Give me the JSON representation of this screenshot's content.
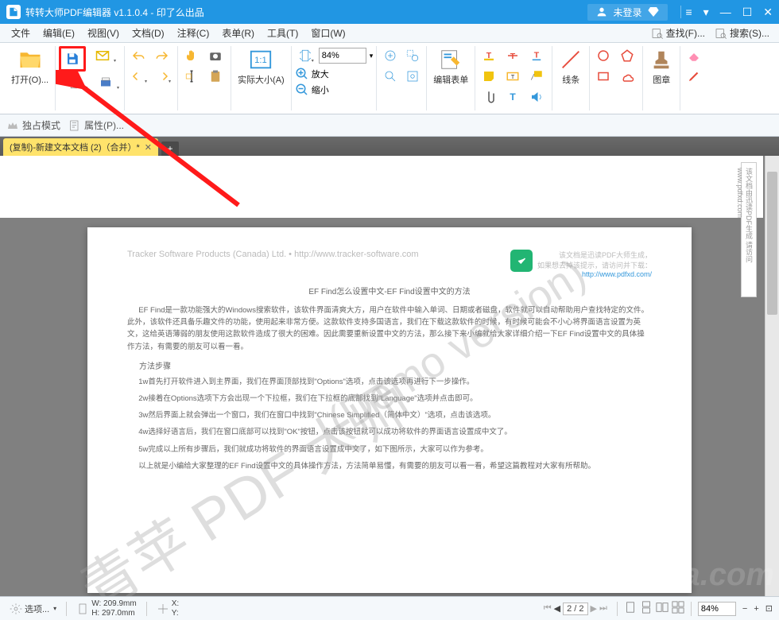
{
  "titlebar": {
    "title": "转转大师PDF编辑器 v1.1.0.4 - 印了么出品",
    "user_status": "未登录"
  },
  "menubar": {
    "items": [
      "文件",
      "编辑(E)",
      "视图(V)",
      "文档(D)",
      "注释(C)",
      "表单(R)",
      "工具(T)",
      "窗口(W)"
    ],
    "find_label": "查找(F)...",
    "search_label": "搜索(S)..."
  },
  "ribbon": {
    "open_label": "打开(O)...",
    "actual_size_label": "实际大小(A)",
    "zoom_value": "84%",
    "zoom_in_label": "放大",
    "zoom_out_label": "缩小",
    "edit_form_label": "编辑表单",
    "lines_label": "线条",
    "stamp_label": "图章"
  },
  "secondbar": {
    "exclusive_label": "独占模式",
    "props_label": "属性(P)..."
  },
  "tabbar": {
    "tab1": "(复制)-新建文本文档 (2)（合并）*"
  },
  "document": {
    "header_left": "Tracker Software Products (Canada) Ltd. • http://www.tracker-software.com",
    "header_note1": "该文档是迅读PDF大师生成，",
    "header_note2": "如果想去掉该提示，请访问并下载：",
    "header_link": "http://www.pdfxd.com/",
    "subtitle": "EF Find怎么设置中文-EF Find设置中文的方法",
    "para1": "EF Find是一款功能强大的Windows搜索软件，该软件界面清爽大方，用户在软件中输入单词、日期或者磁盘，软件就可以自动帮助用户查找特定的文件。此外，该软件还具备乐趣文件的功能，使用起来非常方便。这款软件支持多国语言，我们在下载这款软件的时候，有时候可能会不小心将界面语言设置为英文，这给英语薄弱的朋友使用这款软件造成了很大的困难。因此需要重新设置中文的方法，那么接下来小编就给大家详细介绍一下EF Find设置中文的具体操作方法，有需要的朋友可以看一看。",
    "section_title": "方法步骤",
    "step1": "1w首先打开软件进入到主界面，我们在界面顶部找到\"Options\"选项，点击该选项再进行下一步操作。",
    "step2": "2w接着在Options选项下方会出现一个下拉框，我们在下拉框的底部找到\"Language\"选项并点击即可。",
    "step3": "3w然后界面上就会弹出一个窗口，我们在窗口中找到\"Chinese Simplified（简体中文）\"选项，点击该选项。",
    "step4": "4w选择好语言后，我们在窗口底部可以找到\"OK\"按钮，点击该按钮就可以成功将软件的界面语言设置成中文了。",
    "step5": "5w完成以上所有步骤后，我们就成功将软件的界面语言设置成中文了，如下图所示，大家可以作为参考。",
    "para2": "以上就是小编给大家整理的EF Find设置中文的具体操作方法，方法简单易懂，有需要的朋友可以看一看，希望这篇教程对大家有所帮助。"
  },
  "watermarks": {
    "wm1": "青苹 PDF 大师",
    "wm2": "(Demo version)",
    "site": "下载吧 www.xiazaiba.com"
  },
  "statusbar": {
    "options_label": "选项...",
    "w_label": "W:",
    "w_value": "209.9mm",
    "h_label": "H:",
    "h_value": "297.0mm",
    "x_label": "X:",
    "y_label": "Y:",
    "page_current": "2",
    "page_total": "2",
    "zoom_value": "84%"
  }
}
